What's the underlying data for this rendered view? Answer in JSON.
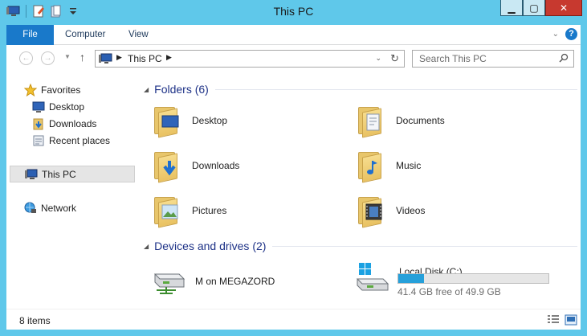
{
  "window": {
    "title": "This PC"
  },
  "ribbon": {
    "tabs": [
      "File",
      "Computer",
      "View"
    ]
  },
  "address": {
    "location": "This PC"
  },
  "search": {
    "placeholder": "Search This PC"
  },
  "navpane": {
    "favorites": "Favorites",
    "favorite_items": [
      "Desktop",
      "Downloads",
      "Recent places"
    ],
    "this_pc": "This PC",
    "network": "Network"
  },
  "content": {
    "folders_header": "Folders (6)",
    "folders": [
      "Desktop",
      "Documents",
      "Downloads",
      "Music",
      "Pictures",
      "Videos"
    ],
    "drives_header": "Devices and drives (2)",
    "drives": [
      {
        "name": "M on MEGAZORD"
      },
      {
        "name": "Local Disk (C:)",
        "free_text": "41.4 GB free of 49.9 GB",
        "used_fraction": 0.17
      }
    ]
  },
  "status": {
    "items": "8 items"
  },
  "colors": {
    "frame": "#5fc8ea",
    "file_tab": "#1979ca",
    "group_header": "#1e3287",
    "usage_bar": "#26a0da",
    "close_button": "#c7392f"
  }
}
